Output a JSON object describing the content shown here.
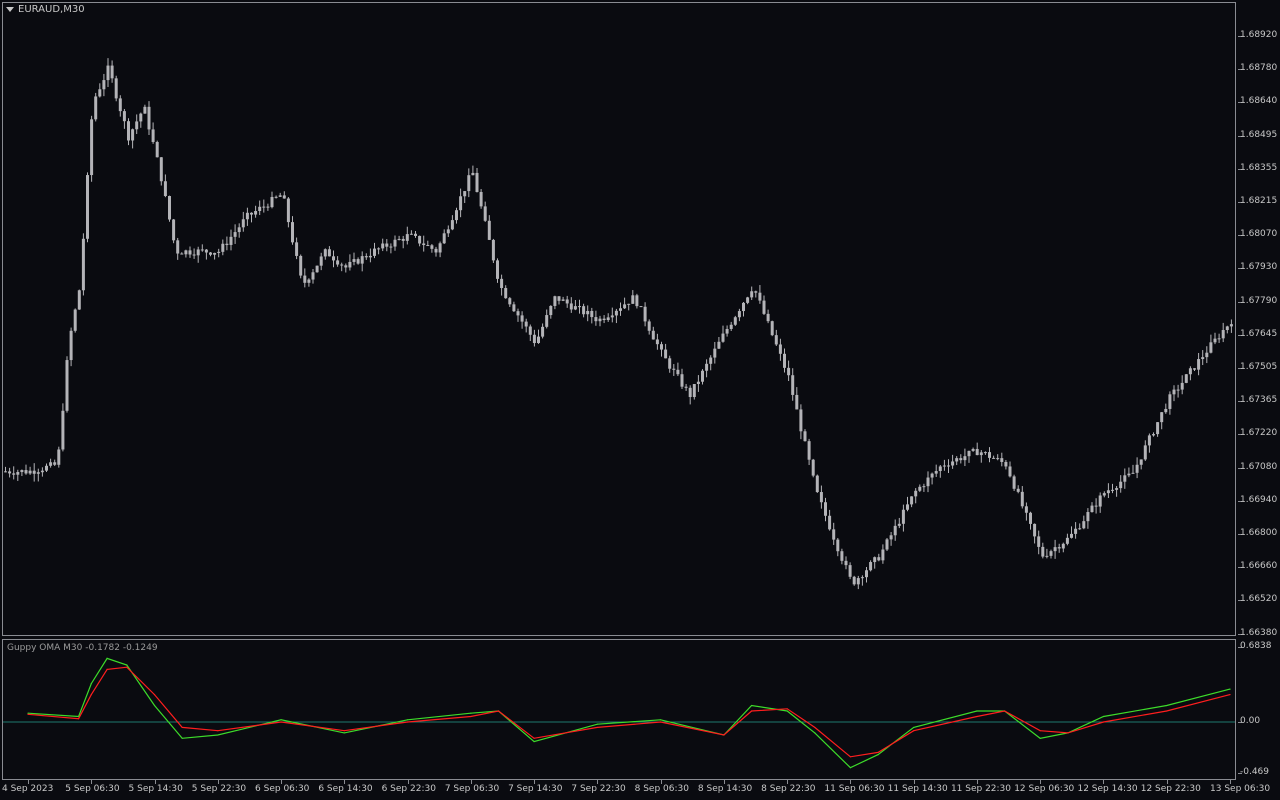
{
  "symbol_title": "EURAUD,M30",
  "indicator_title": "Guppy OMA M30 -0.1782 -0.1249",
  "colors": {
    "background": "#0a0b10",
    "frame": "#8a8c92",
    "candle": "#b4b4b8",
    "fast_line": "#3ddc2a",
    "slow_line": "#ff1e1e",
    "zero_line": "#1e7a6e",
    "text": "#c8c8c8"
  },
  "price_axis": [
    "1.68920",
    "1.68780",
    "1.68640",
    "1.68495",
    "1.68355",
    "1.68215",
    "1.68070",
    "1.67930",
    "1.67790",
    "1.67645",
    "1.67505",
    "1.67365",
    "1.67220",
    "1.67080",
    "1.66940",
    "1.66800",
    "1.66660",
    "1.66520",
    "1.66380"
  ],
  "indicator_axis": [
    "0.6838",
    "0.00",
    "-0.469"
  ],
  "time_axis": [
    "4 Sep 2023",
    "5 Sep 06:30",
    "5 Sep 14:30",
    "5 Sep 22:30",
    "6 Sep 06:30",
    "6 Sep 14:30",
    "6 Sep 22:30",
    "7 Sep 06:30",
    "7 Sep 14:30",
    "7 Sep 22:30",
    "8 Sep 06:30",
    "8 Sep 14:30",
    "8 Sep 22:30",
    "11 Sep 06:30",
    "11 Sep 14:30",
    "11 Sep 22:30",
    "12 Sep 06:30",
    "12 Sep 14:30",
    "12 Sep 22:30",
    "13 Sep 06:30"
  ],
  "chart_data": [
    {
      "type": "candlestick",
      "symbol": "EURAUD",
      "timeframe": "M30",
      "ylim": [
        1.6638,
        1.6899
      ],
      "close_path": [
        {
          "x": "4 Sep 2023",
          "y": 1.6709
        },
        {
          "x": "4 Sep 18:00",
          "y": 1.6712
        },
        {
          "x": "4 Sep 22:00",
          "y": 1.6765
        },
        {
          "x": "5 Sep 02:00",
          "y": 1.679
        },
        {
          "x": "5 Sep 06:30",
          "y": 1.687
        },
        {
          "x": "5 Sep 08:30",
          "y": 1.6885
        },
        {
          "x": "5 Sep 11:00",
          "y": 1.6855
        },
        {
          "x": "5 Sep 13:00",
          "y": 1.6868
        },
        {
          "x": "5 Sep 15:00",
          "y": 1.684
        },
        {
          "x": "5 Sep 17:00",
          "y": 1.6805
        },
        {
          "x": "5 Sep 22:30",
          "y": 1.6805
        },
        {
          "x": "6 Sep 02:00",
          "y": 1.682
        },
        {
          "x": "6 Sep 06:30",
          "y": 1.683
        },
        {
          "x": "6 Sep 09:00",
          "y": 1.679
        },
        {
          "x": "6 Sep 12:00",
          "y": 1.6805
        },
        {
          "x": "6 Sep 14:30",
          "y": 1.6798
        },
        {
          "x": "6 Sep 18:00",
          "y": 1.6805
        },
        {
          "x": "6 Sep 22:30",
          "y": 1.6812
        },
        {
          "x": "7 Sep 02:00",
          "y": 1.6805
        },
        {
          "x": "7 Sep 06:30",
          "y": 1.684
        },
        {
          "x": "7 Sep 10:00",
          "y": 1.679
        },
        {
          "x": "7 Sep 14:30",
          "y": 1.6765
        },
        {
          "x": "7 Sep 17:00",
          "y": 1.6785
        },
        {
          "x": "7 Sep 22:30",
          "y": 1.6775
        },
        {
          "x": "8 Sep 03:00",
          "y": 1.6785
        },
        {
          "x": "8 Sep 06:30",
          "y": 1.676
        },
        {
          "x": "8 Sep 10:00",
          "y": 1.6742
        },
        {
          "x": "8 Sep 14:30",
          "y": 1.677
        },
        {
          "x": "8 Sep 18:00",
          "y": 1.679
        },
        {
          "x": "8 Sep 22:30",
          "y": 1.675
        },
        {
          "x": "11 Sep 02:00",
          "y": 1.67
        },
        {
          "x": "11 Sep 06:30",
          "y": 1.666
        },
        {
          "x": "11 Sep 10:00",
          "y": 1.6672
        },
        {
          "x": "11 Sep 14:30",
          "y": 1.67
        },
        {
          "x": "11 Sep 18:00",
          "y": 1.6712
        },
        {
          "x": "11 Sep 22:30",
          "y": 1.6718
        },
        {
          "x": "12 Sep 02:00",
          "y": 1.6712
        },
        {
          "x": "12 Sep 06:30",
          "y": 1.6672
        },
        {
          "x": "12 Sep 10:00",
          "y": 1.668
        },
        {
          "x": "12 Sep 14:30",
          "y": 1.67
        },
        {
          "x": "12 Sep 18:00",
          "y": 1.6708
        },
        {
          "x": "12 Sep 22:30",
          "y": 1.674
        },
        {
          "x": "13 Sep 03:00",
          "y": 1.676
        },
        {
          "x": "13 Sep 06:30",
          "y": 1.6775
        }
      ]
    },
    {
      "type": "line",
      "title": "Guppy OMA M30 -0.1782 -0.1249",
      "ylim": [
        -0.469,
        0.6838
      ],
      "zero_line": 0.0,
      "x": [
        "4 Sep 2023",
        "5 Sep 02:00",
        "5 Sep 06:30",
        "5 Sep 08:30",
        "5 Sep 11:00",
        "5 Sep 14:30",
        "5 Sep 18:00",
        "5 Sep 22:30",
        "6 Sep 06:30",
        "6 Sep 14:30",
        "6 Sep 22:30",
        "7 Sep 06:30",
        "7 Sep 10:00",
        "7 Sep 14:30",
        "7 Sep 22:30",
        "8 Sep 06:30",
        "8 Sep 14:30",
        "8 Sep 18:00",
        "8 Sep 22:30",
        "11 Sep 02:00",
        "11 Sep 06:30",
        "11 Sep 10:00",
        "11 Sep 14:30",
        "11 Sep 22:30",
        "12 Sep 02:00",
        "12 Sep 06:30",
        "12 Sep 10:00",
        "12 Sep 14:30",
        "12 Sep 22:30",
        "13 Sep 06:30"
      ],
      "series": [
        {
          "values": [
            0.08,
            0.05,
            0.35,
            0.58,
            0.52,
            0.15,
            -0.15,
            -0.12,
            0.02,
            -0.1,
            0.02,
            0.08,
            0.1,
            -0.18,
            -0.02,
            0.02,
            -0.12,
            0.15,
            0.1,
            -0.1,
            -0.42,
            -0.3,
            -0.05,
            0.1,
            0.1,
            -0.15,
            -0.1,
            0.05,
            0.15,
            0.3
          ]
        },
        {
          "values": [
            0.07,
            0.03,
            0.25,
            0.48,
            0.5,
            0.25,
            -0.05,
            -0.08,
            0.0,
            -0.08,
            0.0,
            0.05,
            0.1,
            -0.15,
            -0.05,
            0.0,
            -0.12,
            0.1,
            0.12,
            -0.05,
            -0.32,
            -0.28,
            -0.08,
            0.05,
            0.1,
            -0.08,
            -0.1,
            0.0,
            0.1,
            0.25
          ]
        }
      ]
    }
  ]
}
